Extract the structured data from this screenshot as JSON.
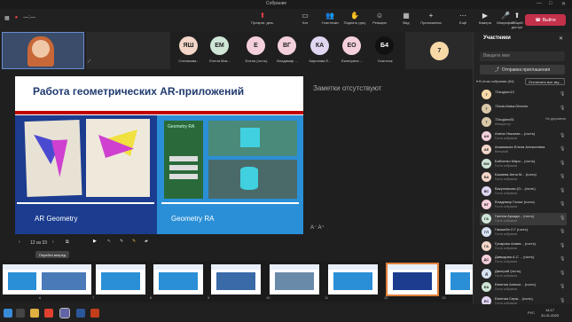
{
  "window": {
    "title": "Собрание"
  },
  "toolbar": {
    "timer": "—:—",
    "buttons": [
      {
        "label": "Прекрат. дем."
      },
      {
        "label": "Чат"
      },
      {
        "label": "Участники"
      },
      {
        "label": "Поднять руку"
      },
      {
        "label": "Реакции"
      },
      {
        "label": "Вид"
      },
      {
        "label": "Приложения"
      },
      {
        "label": "Ещё"
      },
      {
        "label": "Камера"
      },
      {
        "label": "Микрофон"
      },
      {
        "label": "Общий доступ"
      }
    ],
    "leave_label": "Выйти"
  },
  "strip": {
    "tiles": [
      {
        "initials": "ЯШ",
        "name": "Слепикова...",
        "color": "#f3d6c8"
      },
      {
        "initials": "ЕМ",
        "name": "Елена Мак...",
        "color": "#cfe6d6"
      },
      {
        "initials": "Е",
        "name": "Елена (гость)",
        "color": "#f4d0dc"
      },
      {
        "initials": "ВГ",
        "name": "Владимир ...",
        "color": "#f4d0dc"
      },
      {
        "initials": "КА",
        "name": "Кирилова Е...",
        "color": "#e0d6f2"
      },
      {
        "initials": "ЕО",
        "name": "Екатерина ...",
        "color": "#f4d0dc"
      },
      {
        "initials": "Б4",
        "name": "Участник",
        "color": "#111111"
      },
      {
        "initials": "7",
        "name": "",
        "color": "#f7d9a8"
      }
    ]
  },
  "slide": {
    "title": "Работа геометрических AR-приложений",
    "caption_left": "AR Geometry",
    "caption_right": "Geometry RA",
    "app_title": "Geometry RA"
  },
  "notes": "Заметки отсутствуют",
  "zoom": "A⁻  A⁺",
  "nav": {
    "page": "12 из 33",
    "tooltip": "Перейти вперед"
  },
  "thumbnails": {
    "numbers": [
      "6",
      "7",
      "8",
      "9",
      "10",
      "11",
      "12",
      "13"
    ],
    "selected": "12"
  },
  "taskbar": {
    "lang": "РУС",
    "time": "14:17",
    "date": "31.01.2023"
  },
  "panel": {
    "title": "Участники",
    "search_placeholder": "Введите имя",
    "invite_label": "Отправка приглашения",
    "lobby": "В этом собрании (64)",
    "mute_all": "Отключить все зву...",
    "people": [
      {
        "initials": "7",
        "name": "72sugiorc12",
        "role": "",
        "status": "",
        "color": "#f7d9a8"
      },
      {
        "initials": "7",
        "name": "72sda-Maka-Director",
        "role": "",
        "status": "",
        "color": "#d8c8a8"
      },
      {
        "initials": "7",
        "name": "72sugiorc81",
        "role": "Инициатор",
        "status": "На удержании",
        "color": "#d8c8a8"
      },
      {
        "initials": "АН",
        "name": "Алена Николае... (гость)",
        "role": "Гость собрания",
        "status": "",
        "color": "#f4d0dc"
      },
      {
        "initials": "АЕ",
        "name": "Ахаимахна Елена Алексеевна",
        "role": "Внешний",
        "status": "",
        "color": "#f3d6c8"
      },
      {
        "initials": "БМ",
        "name": "Бабченко Мари... (гость)",
        "role": "Гость собрания",
        "status": "",
        "color": "#cfe6d6"
      },
      {
        "initials": "БА",
        "name": "Базаева Анна М... (гость)",
        "role": "Гость собрания",
        "status": "",
        "color": "#f3d6c8"
      },
      {
        "initials": "ВС",
        "name": "Вакуловская (О... (гость)",
        "role": "Гость собрания",
        "status": "",
        "color": "#e0d6f2"
      },
      {
        "initials": "ВГ",
        "name": "Владимир Голые (гость)",
        "role": "Гость собрания",
        "status": "",
        "color": "#f4d0dc"
      },
      {
        "initials": "ГА",
        "name": "Ганина Аркади... (гость)",
        "role": "Гость собрания",
        "status": "",
        "color": "#cfe6d6"
      },
      {
        "initials": "ГЛ",
        "name": "Гамшейн Л.Г (гость)",
        "role": "Гость собрания",
        "status": "",
        "color": "#d6e2f2"
      },
      {
        "initials": "ГА",
        "name": "Гусарова Анаев... (гость)",
        "role": "Гость собрания",
        "status": "",
        "color": "#f3d6c8"
      },
      {
        "initials": "ДС",
        "name": "Давыдова А.С ... (гость)",
        "role": "Гость собрания",
        "status": "",
        "color": "#f4d0dc"
      },
      {
        "initials": "Д",
        "name": "Дмитрий (гость)",
        "role": "Гость собрания",
        "status": "",
        "color": "#d6e2f2"
      },
      {
        "initials": "ЕА",
        "name": "Евгения Алексе... (гость)",
        "role": "Гость собрания",
        "status": "",
        "color": "#cfe6d6"
      },
      {
        "initials": "ЕС",
        "name": "Евгения Серж... (гость)",
        "role": "Гость собрания",
        "status": "",
        "color": "#e0d6f2"
      }
    ]
  }
}
